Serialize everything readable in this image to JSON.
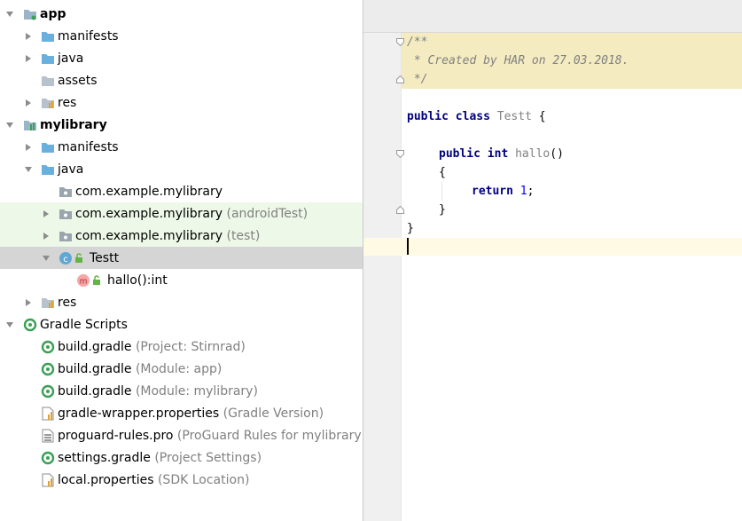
{
  "tree": {
    "items": [
      {
        "label": "app",
        "hint": ""
      },
      {
        "label": "manifests",
        "hint": ""
      },
      {
        "label": "java",
        "hint": ""
      },
      {
        "label": "assets",
        "hint": ""
      },
      {
        "label": "res",
        "hint": ""
      },
      {
        "label": "mylibrary",
        "hint": ""
      },
      {
        "label": "manifests",
        "hint": ""
      },
      {
        "label": "java",
        "hint": ""
      },
      {
        "label": "com.example.mylibrary",
        "hint": ""
      },
      {
        "label": "com.example.mylibrary",
        "hint": "(androidTest)"
      },
      {
        "label": "com.example.mylibrary",
        "hint": "(test)"
      },
      {
        "label": "Testt",
        "hint": "",
        "badge": "C"
      },
      {
        "label": "hallo():int",
        "hint": "",
        "badge": "m"
      },
      {
        "label": "res",
        "hint": ""
      },
      {
        "label": "Gradle Scripts",
        "hint": ""
      },
      {
        "label": "build.gradle",
        "hint": "(Project: Stirnrad)"
      },
      {
        "label": "build.gradle",
        "hint": "(Module: app)"
      },
      {
        "label": "build.gradle",
        "hint": "(Module: mylibrary)"
      },
      {
        "label": "gradle-wrapper.properties",
        "hint": "(Gradle Version)"
      },
      {
        "label": "proguard-rules.pro",
        "hint": "(ProGuard Rules for mylibrary)"
      },
      {
        "label": "settings.gradle",
        "hint": "(Project Settings)"
      },
      {
        "label": "local.properties",
        "hint": "(SDK Location)"
      }
    ]
  },
  "editor": {
    "tokens": {
      "doc_open": "/**",
      "doc_line": " * Created by HAR on 27.03.2018.",
      "doc_close": " */",
      "kw_public": "public",
      "kw_class": "class",
      "class_name": "Testt",
      "brace_open": "{",
      "kw_int": "int",
      "method_name": "hallo",
      "parens": "()",
      "kw_return": "return",
      "num_one": "1",
      "semicolon": ";",
      "brace_close": "}"
    }
  },
  "colors": {
    "accent_folder": "#6ab0de",
    "gradle_green": "#3aa055",
    "selected_row": "#d5d5d5",
    "test_row": "#eef8e8",
    "keyword": "#000080",
    "doc_comment_bg": "#f4ebc1"
  }
}
